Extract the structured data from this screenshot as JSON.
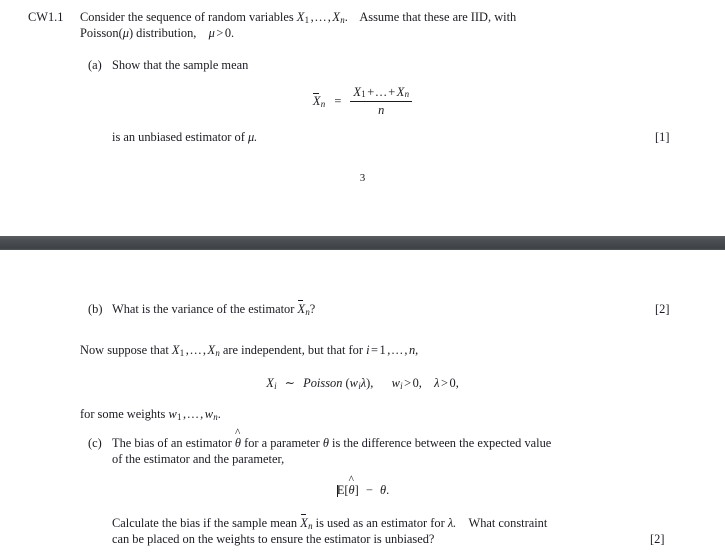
{
  "document": {
    "type": "exam-coursework-page",
    "page_number": "3",
    "background_color": "#ffffff",
    "text_color": "#1a1a22",
    "divider_color": "#4a4e52"
  },
  "page_top": {
    "question": {
      "number": "CW1.1",
      "text_line1": "Consider the sequence of random variables",
      "math_sequence": "X₁,…, Xₙ.",
      "text_line1_cont": "Assume that these are IID, with",
      "text_line2_a": "Poisson(",
      "text_line2_mu": "μ",
      "text_line2_b": ") distribution,",
      "text_line2_cond": "μ > 0."
    },
    "part_a": {
      "label": "(a)",
      "text": "Show that the sample mean",
      "equation": {
        "lhs": "X̄ₙ",
        "relation": "=",
        "numerator": "X₁ + … + Xₙ",
        "denominator": "n"
      },
      "closing_text": "is an unbiased estimator of",
      "closing_symbol": "μ.",
      "marks": "[1]"
    },
    "footer_page_number": "3"
  },
  "page_bottom": {
    "part_b": {
      "label": "(b)",
      "text": "What is the variance of the estimator",
      "symbol": "X̄ₙ?",
      "marks": "[2]"
    },
    "intro_paragraph": {
      "text_a": "Now suppose that",
      "math_a": "X₁,…, Xₙ",
      "text_b": "are independent, but that for",
      "math_b": "i = 1,…, n,"
    },
    "display_equation": {
      "lhs": "Xᵢ",
      "relation": "∼",
      "distribution": "Poisson",
      "argument": "(wᵢλ),",
      "conditions": "wᵢ > 0,  λ > 0,"
    },
    "weights_line": {
      "text": "for some weights",
      "math": "w₁,…, wₙ."
    },
    "part_c": {
      "label": "(c)",
      "line1_a": "The bias of an estimator",
      "line1_theta_hat": "θ̂",
      "line1_b": "for a parameter",
      "line1_theta": "θ",
      "line1_c": "is the difference between the expected value",
      "line2": "of the estimator and the parameter,",
      "equation": "ᴇ[θ̂] − θ.",
      "line3_a": "Calculate the bias if the sample mean",
      "line3_math": "X̄ₙ",
      "line3_b": "is used as an estimator for",
      "line3_lambda": "λ.",
      "line3_c": "What constraint",
      "line4": "can be placed on the weights to ensure the estimator is unbiased?",
      "marks": "[2]"
    }
  }
}
